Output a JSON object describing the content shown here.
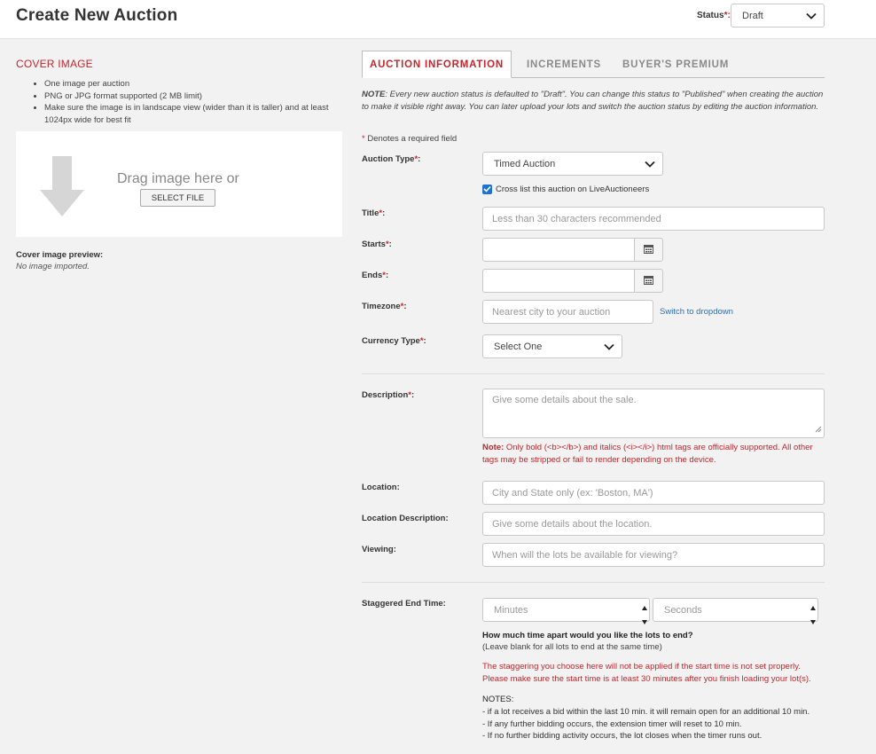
{
  "header": {
    "title": "Create New Auction",
    "status_label": "Status",
    "status_required": "*:",
    "status_value": "Draft"
  },
  "cover": {
    "heading": "COVER IMAGE",
    "bullets": [
      "One image per auction",
      "PNG or JPG format supported (2 MB limit)",
      "Make sure the image is in landscape view (wider than it is taller) and at least 1024px wide for best fit"
    ],
    "drop_text": "Drag image here or",
    "select_file": "SELECT FILE",
    "preview_label": "Cover image preview:",
    "preview_empty": "No image imported."
  },
  "tabs": [
    "AUCTION INFORMATION",
    "INCREMENTS",
    "BUYER'S PREMIUM"
  ],
  "note": {
    "prefix": "NOTE",
    "text": ": Every new auction status is defaulted to \"Draft\". You can change this status to \"Published\" when creating the auction to make it visible right away. You can later upload your lots and switch the auction status by editing the auction information."
  },
  "required_note": {
    "star": "*",
    "text": " Denotes a required field"
  },
  "form": {
    "auction_type": {
      "label": "Auction Type",
      "req": "*",
      "colon": ":",
      "value": "Timed Auction"
    },
    "cross_list": {
      "label": "Cross list this auction on LiveAuctioneers",
      "checked": true
    },
    "title": {
      "label": "Title",
      "req": "*",
      "colon": ":",
      "placeholder": "Less than 30 characters recommended"
    },
    "starts": {
      "label": "Starts",
      "req": "*",
      "colon": ":",
      "value": ""
    },
    "ends": {
      "label": "Ends",
      "req": "*",
      "colon": ":",
      "value": ""
    },
    "timezone": {
      "label": "Timezone",
      "req": "*",
      "colon": ":",
      "placeholder": "Nearest city to your auction",
      "switch_link": "Switch to dropdown"
    },
    "currency": {
      "label": "Currency Type",
      "req": "*",
      "colon": ":",
      "value": "Select One"
    },
    "description": {
      "label": "Description",
      "req": "*",
      "colon": ":",
      "placeholder": "Give some details about the sale.",
      "note_prefix": "Note:",
      "note_text": " Only bold (<b></b>) and italics (<i></i>) html tags are officially supported. All other tags may be stripped or fail to render depending on the device."
    },
    "location": {
      "label": "Location:",
      "placeholder": "City and State only (ex: 'Boston, MA')"
    },
    "location_description": {
      "label": "Location Description:",
      "placeholder": "Give some details about the location."
    },
    "viewing": {
      "label": "Viewing:",
      "placeholder": "When will the lots be available for viewing?"
    },
    "staggered": {
      "label": "Staggered End Time:",
      "minutes_placeholder": "Minutes",
      "seconds_placeholder": "Seconds",
      "question": "How much time apart would you like the lots to end?",
      "question_sub": "(Leave blank for all lots to end at the same time)",
      "warning_1": "The staggering you choose here will not be applied if the start time is not set properly.",
      "warning_2": "Please make sure the start time is at least 30 minutes after you finish loading your lot(s).",
      "notes_heading": "NOTES:",
      "notes": [
        "- if a lot receives a bid within the last 10 min. it will remain open for an additional 10 min.",
        "- If any further bidding occurs, the extension timer will reset to 10 min.",
        "- If no further bidding activity occurs, the lot closes when the timer runs out."
      ]
    }
  },
  "colors": {
    "accent_red": "#c1272d",
    "link_blue": "#2a6ebb",
    "checkbox_blue": "#1e72d0"
  },
  "icons": [
    "chevron-down-icon",
    "down-arrow-icon",
    "calendar-icon",
    "check-icon",
    "spinner-up-icon",
    "spinner-down-icon",
    "resize-handle-icon"
  ]
}
